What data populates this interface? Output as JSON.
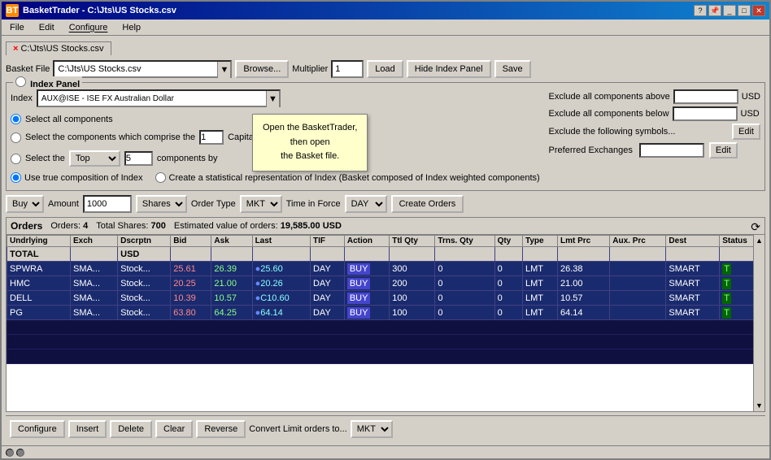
{
  "window": {
    "title": "BasketTrader - C:\\Jts\\US Stocks.csv",
    "icon": "BT"
  },
  "menu": {
    "items": [
      "File",
      "Edit",
      "Configure",
      "Help"
    ]
  },
  "tab": {
    "label": "C:\\Jts\\US Stocks.csv",
    "close": "×"
  },
  "basket": {
    "label": "Basket File",
    "file": "C:\\Jts\\US Stocks.csv",
    "multiplier_label": "Multiplier",
    "multiplier_value": "1",
    "browse_label": "Browse...",
    "load_label": "Load",
    "hide_panel_label": "Hide Index Panel",
    "save_label": "Save"
  },
  "index_panel": {
    "title": "Index Panel",
    "index_label": "Index",
    "index_value": "AUX@ISE - ISE FX Australian Dollar",
    "select_all_label": "Select all components",
    "select_comprise_label": "Select the components which comprise the",
    "select_top_label": "Select the",
    "top_value": "Top",
    "top_number": "5",
    "top_suffix": "components by",
    "capitalization": "Capitalization",
    "use_true_label": "Use true composition of Index",
    "create_stat_label": "Create a statistical representation of Index (Basket composed of Index weighted components)",
    "exclude_above_label": "Exclude all components above",
    "exclude_above_unit": "USD",
    "exclude_below_label": "Exclude all components below",
    "exclude_below_unit": "USD",
    "exclude_symbols_label": "Exclude the following symbols...",
    "edit1_label": "Edit",
    "preferred_label": "Preferred Exchanges",
    "edit2_label": "Edit"
  },
  "order_bar": {
    "side_label": "Buy",
    "amount_label": "Amount",
    "amount_value": "1000",
    "shares_label": "Shares",
    "order_type_label": "Order Type",
    "order_type_value": "MKT",
    "time_label": "Time in Force",
    "time_value": "DAY",
    "create_orders_label": "Create Orders"
  },
  "orders": {
    "title": "Orders",
    "count_label": "Orders:",
    "count_value": "4",
    "shares_label": "Total Shares:",
    "shares_value": "700",
    "estimated_label": "Estimated value of orders:",
    "estimated_value": "19,585.00 USD",
    "columns": [
      "Undrlying",
      "Exch",
      "Dscrptn",
      "Bid",
      "Ask",
      "Last",
      "TIF",
      "Action",
      "Ttl Qty",
      "Trns. Qty",
      "Qty",
      "Type",
      "Lmt Prc",
      "Aux. Prc",
      "Dest",
      "Status"
    ],
    "total_row": [
      "TOTAL",
      "",
      "USD",
      "",
      "",
      "",
      "",
      "",
      "",
      "",
      "",
      "",
      "",
      "",
      "",
      ""
    ],
    "rows": [
      {
        "symbol": "SPWRA",
        "exch": "SMA...",
        "desc": "Stock...",
        "bid": "25.61",
        "ask": "26.39",
        "last": "25.60",
        "tif": "DAY",
        "action": "BUY",
        "ttl_qty": "300",
        "trns_qty": "0",
        "qty": "0",
        "type": "LMT",
        "lmt_prc": "26.38",
        "aux_prc": "",
        "dest": "SMART",
        "status": "T"
      },
      {
        "symbol": "HMC",
        "exch": "SMA...",
        "desc": "Stock...",
        "bid": "20.25",
        "ask": "21.00",
        "last": "20.26",
        "tif": "DAY",
        "action": "BUY",
        "ttl_qty": "200",
        "trns_qty": "0",
        "qty": "0",
        "type": "LMT",
        "lmt_prc": "21.00",
        "aux_prc": "",
        "dest": "SMART",
        "status": "T"
      },
      {
        "symbol": "DELL",
        "exch": "SMA...",
        "desc": "Stock...",
        "bid": "10.39",
        "ask": "10.57",
        "last": "C10.60",
        "tif": "DAY",
        "action": "BUY",
        "ttl_qty": "100",
        "trns_qty": "0",
        "qty": "0",
        "type": "LMT",
        "lmt_prc": "10.57",
        "aux_prc": "",
        "dest": "SMART",
        "status": "T"
      },
      {
        "symbol": "PG",
        "exch": "SMA...",
        "desc": "Stock...",
        "bid": "63.80",
        "ask": "64.25",
        "last": "64.14",
        "tif": "DAY",
        "action": "BUY",
        "ttl_qty": "100",
        "trns_qty": "0",
        "qty": "0",
        "type": "LMT",
        "lmt_prc": "64.14",
        "aux_prc": "",
        "dest": "SMART",
        "status": "T"
      }
    ]
  },
  "bottom_toolbar": {
    "configure_label": "Configure",
    "insert_label": "Insert",
    "delete_label": "Delete",
    "clear_label": "Clear",
    "reverse_label": "Reverse",
    "convert_label": "Convert Limit orders to...",
    "convert_value": "MKT"
  },
  "tooltip": {
    "line1": "Open the BasketTrader,",
    "line2": "then open",
    "line3": "the Basket file."
  }
}
